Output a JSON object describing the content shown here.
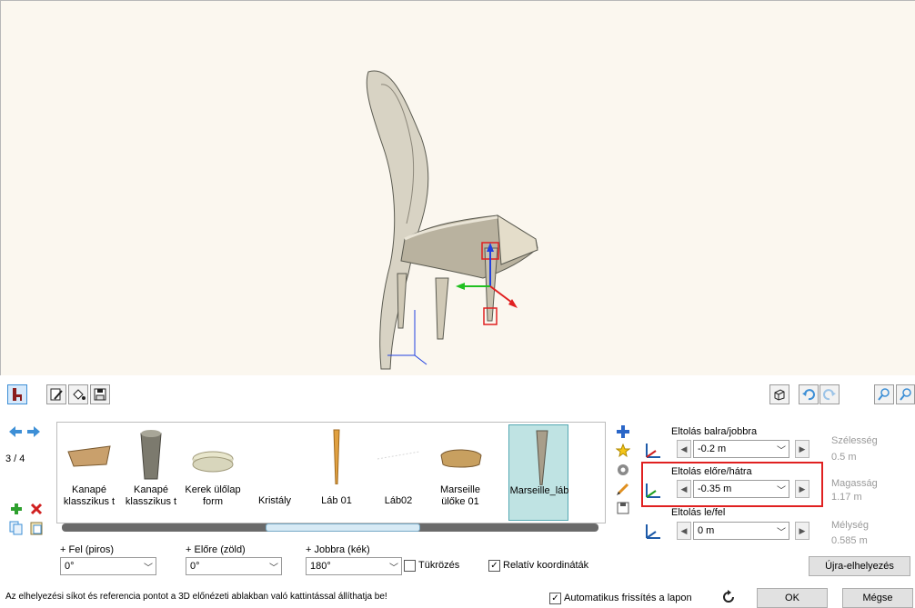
{
  "counter": "3 / 4",
  "gallery": [
    {
      "label": "Kanapé klasszikus t"
    },
    {
      "label": "Kanapé klasszikus t"
    },
    {
      "label": "Kerek ülőlap form"
    },
    {
      "label": "Kristály"
    },
    {
      "label": "Láb 01"
    },
    {
      "label": "Láb02"
    },
    {
      "label": "Marseille ülőke 01"
    },
    {
      "label": "Marseille_láb"
    }
  ],
  "offsets": {
    "x_label": "Eltolás balra/jobbra",
    "x_value": "-0.2 m",
    "y_label": "Eltolás előre/hátra",
    "y_value": "-0.35 m",
    "z_label": "Eltolás le/fel",
    "z_value": "0 m"
  },
  "dimensions": {
    "width_label": "Szélesség",
    "width_value": "0.5 m",
    "height_label": "Magasság",
    "height_value": "1.17 m",
    "depth_label": "Mélység",
    "depth_value": "0.585 m"
  },
  "rotations": {
    "up_label": "+ Fel (piros)",
    "up_value": "0°",
    "fwd_label": "+ Előre (zöld)",
    "fwd_value": "0°",
    "right_label": "+ Jobbra (kék)",
    "right_value": "180°"
  },
  "mirror_label": "Tükrözés",
  "relative_label": "Relatív koordináták",
  "reposition_label": "Újra-elhelyezés",
  "status_text": "Az elhelyezési síkot és referencia pontot a 3D előnézeti ablakban való kattintással állíthatja be!",
  "auto_refresh_label": "Automatikus frissítés a lapon",
  "ok_label": "OK",
  "cancel_label": "Mégse",
  "colors": {
    "highlight": "#e02020",
    "accent": "#3d8fd6",
    "selected_bg": "#bfe3e3"
  }
}
